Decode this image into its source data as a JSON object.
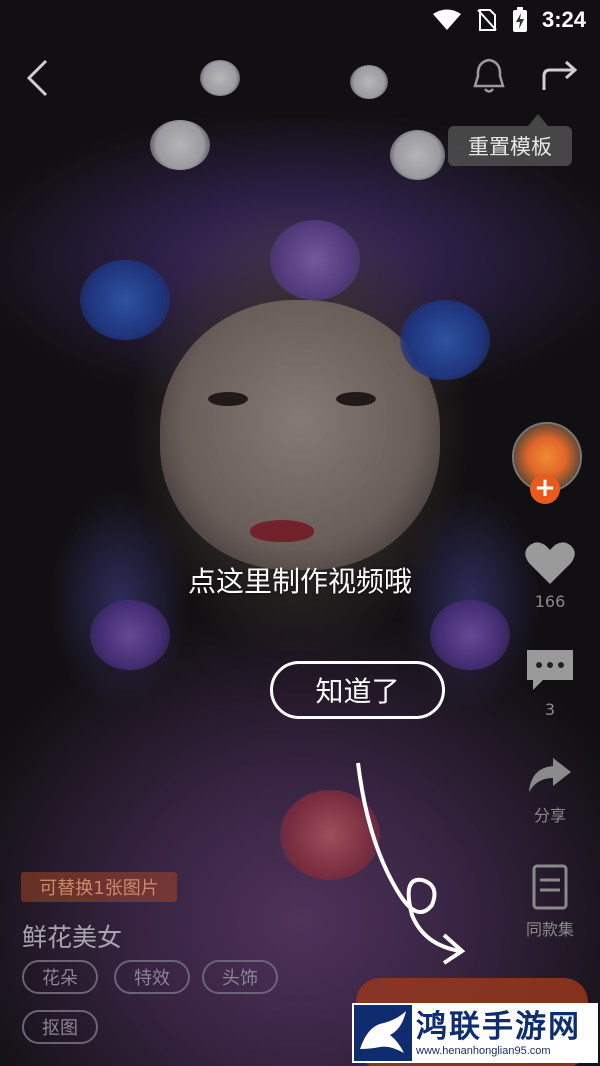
{
  "status_bar": {
    "time": "3:24",
    "icons": [
      "wifi-icon",
      "no-sim-icon",
      "battery-charging-icon"
    ]
  },
  "top_bar": {
    "back_icon": "back-arrow-icon",
    "bell_icon": "bell-icon",
    "share_icon": "share-icon",
    "reset_template_label": "重置模板"
  },
  "tutorial": {
    "tip": "点这里制作视频哦",
    "ok_label": "知道了"
  },
  "side_actions": {
    "like_count": "166",
    "comment_count": "3",
    "share_label": "分享",
    "same_style_label": "同款集"
  },
  "template": {
    "replace_badge": "可替换1张图片",
    "title": "鲜花美女",
    "tags": [
      "花朵",
      "特效",
      "头饰",
      "抠图"
    ]
  },
  "watermark": {
    "title": "鸿联手游网",
    "url": "www.henanhonglian95.com"
  }
}
